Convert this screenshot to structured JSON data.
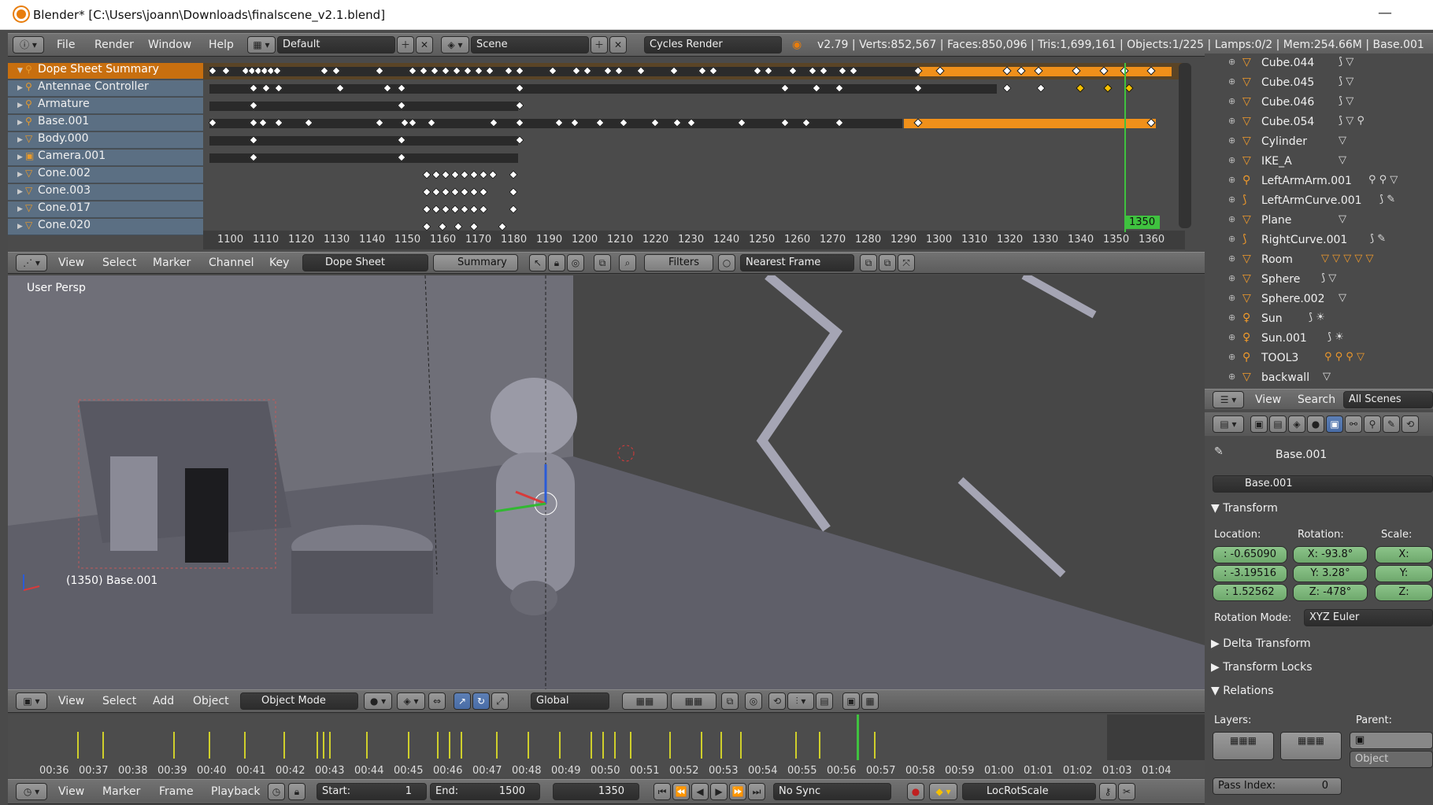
{
  "window": {
    "title": "Blender* [C:\\Users\\joann\\Downloads\\finalscene_v2.1.blend]",
    "minimize": "—"
  },
  "info_header": {
    "menus": [
      "File",
      "Render",
      "Window",
      "Help"
    ],
    "layout": "Default",
    "scene": "Scene",
    "engine": "Cycles Render",
    "stats": "v2.79 | Verts:852,567 | Faces:850,096 | Tris:1,699,161 | Objects:1/225 | Lamps:0/2 | Mem:254.66M | Base.001"
  },
  "dopesheet": {
    "channels": [
      {
        "name": "Dope Sheet Summary",
        "icon": "summary"
      },
      {
        "name": "Antennae Controller",
        "icon": "armature"
      },
      {
        "name": "Armature",
        "icon": "armature"
      },
      {
        "name": "Base.001",
        "icon": "armature"
      },
      {
        "name": "Body.000",
        "icon": "mesh"
      },
      {
        "name": "Camera.001",
        "icon": "camera"
      },
      {
        "name": "Cone.002",
        "icon": "mesh"
      },
      {
        "name": "Cone.003",
        "icon": "mesh"
      },
      {
        "name": "Cone.017",
        "icon": "mesh"
      },
      {
        "name": "Cone.020",
        "icon": "mesh"
      }
    ],
    "ruler": [
      "1100",
      "1110",
      "1120",
      "1130",
      "1140",
      "1150",
      "1160",
      "1170",
      "1180",
      "1190",
      "1200",
      "1210",
      "1220",
      "1230",
      "1240",
      "1250",
      "1260",
      "1270",
      "1280",
      "1290",
      "1300",
      "1310",
      "1320",
      "1330",
      "1340",
      "1350",
      "1360"
    ],
    "current_frame": "1350",
    "header": {
      "menus": [
        "View",
        "Select",
        "Marker",
        "Channel",
        "Key"
      ],
      "mode": "Dope Sheet",
      "summary": "Summary",
      "filters": "Filters",
      "snap": "Nearest Frame"
    }
  },
  "viewport": {
    "label": "User Persp",
    "object_label": "(1350) Base.001",
    "header": {
      "menus": [
        "View",
        "Select",
        "Add",
        "Object"
      ],
      "mode": "Object Mode",
      "orientation": "Global"
    }
  },
  "outliner": {
    "items": [
      {
        "name": "Cube.044",
        "extra": "⟆ ▽"
      },
      {
        "name": "Cube.045",
        "extra": "⟆ ▽"
      },
      {
        "name": "Cube.046",
        "extra": "⟆ ▽"
      },
      {
        "name": "Cube.054",
        "extra": "⟆ ▽ ⚲"
      },
      {
        "name": "Cylinder",
        "extra": "▽"
      },
      {
        "name": "IKE_A",
        "extra": "▽"
      },
      {
        "name": "LeftArmArm.001",
        "extra": "⚲ ⚲ ▽"
      },
      {
        "name": "LeftArmCurve.001",
        "extra": "⟆ ✎"
      },
      {
        "name": "Plane",
        "extra": "▽"
      },
      {
        "name": "RightCurve.001",
        "extra": "⟆ ✎"
      },
      {
        "name": "Room",
        "extra": "▽ ▽ ▽ ▽ ▽"
      },
      {
        "name": "Sphere",
        "extra": "⟆ ▽"
      },
      {
        "name": "Sphere.002",
        "extra": "▽"
      },
      {
        "name": "Sun",
        "extra": "⟆ ☀"
      },
      {
        "name": "Sun.001",
        "extra": "⟆ ☀"
      },
      {
        "name": "TOOL3",
        "extra": "⚲ ⚲ ⚲ ▽"
      },
      {
        "name": "backwall",
        "extra": "▽"
      }
    ],
    "header": {
      "menus": [
        "View",
        "Search"
      ],
      "filter": "All Scenes"
    }
  },
  "properties": {
    "context": "Base.001",
    "object_name": "Base.001",
    "transform_title": "Transform",
    "location_label": "Location:",
    "rotation_label": "Rotation:",
    "scale_label": "Scale:",
    "location": [
      ": -0.65090",
      ": -3.19516",
      ": 1.52562"
    ],
    "rotation": [
      "X:  -93.8°",
      "Y:   3.28°",
      "Z:  -478°"
    ],
    "scale": [
      "X:",
      "Y:",
      "Z:"
    ],
    "rotation_mode_label": "Rotation Mode:",
    "rotation_mode": "XYZ Euler",
    "panels": [
      "Delta Transform",
      "Transform Locks"
    ],
    "relations_title": "Relations",
    "layers_label": "Layers:",
    "parent_label": "Parent:",
    "parent_placeholder": "Object",
    "pass_index_label": "Pass Index:",
    "pass_index": "0"
  },
  "timeline": {
    "ruler": [
      "00:36",
      "00:37",
      "00:38",
      "00:39",
      "00:40",
      "00:41",
      "00:42",
      "00:43",
      "00:44",
      "00:45",
      "00:46",
      "00:47",
      "00:48",
      "00:49",
      "00:50",
      "00:51",
      "00:52",
      "00:53",
      "00:54",
      "00:55",
      "00:56",
      "00:57",
      "00:58",
      "00:59",
      "01:00",
      "01:01",
      "01:02",
      "01:03",
      "01:04"
    ],
    "header": {
      "menus": [
        "View",
        "Marker",
        "Frame",
        "Playback"
      ],
      "start_label": "Start:",
      "start": "1",
      "end_label": "End:",
      "end": "1500",
      "current": "1350",
      "sync": "No Sync",
      "keying_set": "LocRotScale"
    }
  }
}
